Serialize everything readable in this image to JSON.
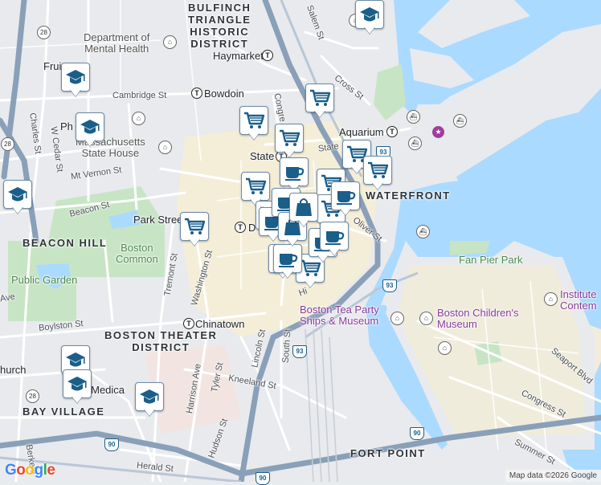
{
  "map": {
    "attribution": "Map data ©2026 Google",
    "logo": "Google",
    "colors": {
      "water": "#aadaff",
      "land": "#e8eaed",
      "park": "#c7e5c4",
      "road": "#ffffff",
      "highway": "#8aa0b8",
      "dense": "#f7efd7",
      "marker_icon": "#1a5e8a"
    }
  },
  "districts": [
    {
      "name": "bulfinch",
      "text": "BULFINCH\nTRIANGLE\nHISTORIC\nDISTRICT"
    },
    {
      "name": "beacon-hill",
      "text": "BEACON HILL"
    },
    {
      "name": "waterfront",
      "text": "WATERFRONT"
    },
    {
      "name": "boston-theater",
      "text": "BOSTON THEATER\nDISTRICT"
    },
    {
      "name": "bay-village",
      "text": "BAY VILLAGE"
    },
    {
      "name": "fort-point",
      "text": "FORT POINT"
    }
  ],
  "places": [
    {
      "name": "haymarket",
      "text": "Haymarket"
    },
    {
      "name": "bowdoin",
      "text": "Bowdoin"
    },
    {
      "name": "aquarium",
      "text": "Aquarium"
    },
    {
      "name": "state",
      "text": "State"
    },
    {
      "name": "park-street",
      "text": "Park Street"
    },
    {
      "name": "chinatown",
      "text": "Chinatown"
    },
    {
      "name": "dept-mental-health",
      "text": "Department of\nMental Health"
    },
    {
      "name": "mass-state-house",
      "text": "Massachusetts\nState House"
    },
    {
      "name": "boston-common",
      "text": "Boston\nCommon"
    },
    {
      "name": "public-garden",
      "text": "Public Garden"
    },
    {
      "name": "fan-pier-park",
      "text": "Fan Pier Park"
    },
    {
      "name": "tea-party",
      "text": "Boston Tea Party\nShips & Museum"
    },
    {
      "name": "childrens-museum",
      "text": "Boston Children's\nMuseum"
    },
    {
      "name": "institute",
      "text": "Institute\nContem"
    },
    {
      "name": "church",
      "text": "hurch"
    },
    {
      "name": "medica",
      "text": "s Medica"
    },
    {
      "name": "d-station",
      "text": "D"
    },
    {
      "name": "fruit",
      "text": "Fruit"
    },
    {
      "name": "ph",
      "text": "Ph"
    }
  ],
  "streets": [
    {
      "name": "cambridge-st",
      "text": "Cambridge St"
    },
    {
      "name": "salem-st",
      "text": "Salem St"
    },
    {
      "name": "cross-st",
      "text": "Cross St"
    },
    {
      "name": "congress-st-n",
      "text": "Congre"
    },
    {
      "name": "state-st",
      "text": "State"
    },
    {
      "name": "mt-vernon-st",
      "text": "Mt Vernon St"
    },
    {
      "name": "charles-st",
      "text": "Charles St"
    },
    {
      "name": "w-cedar-st",
      "text": "W Cedar St"
    },
    {
      "name": "beacon-st",
      "text": "Beacon St"
    },
    {
      "name": "tremont-st",
      "text": "Tremont St"
    },
    {
      "name": "washington-st",
      "text": "Washington St"
    },
    {
      "name": "boylston-st",
      "text": "Boylston St"
    },
    {
      "name": "oliver-st",
      "text": "Oliver St"
    },
    {
      "name": "lincoln-st",
      "text": "Lincoln St"
    },
    {
      "name": "south-st",
      "text": "South St"
    },
    {
      "name": "kneeland-st",
      "text": "Kneeland St"
    },
    {
      "name": "harrison-ave",
      "text": "Harrison Ave"
    },
    {
      "name": "tyler-st",
      "text": "Tyler St"
    },
    {
      "name": "hudson-st",
      "text": "Hudson St"
    },
    {
      "name": "herald-st",
      "text": "Herald St"
    },
    {
      "name": "seaport-blvd",
      "text": "Seaport Blvd"
    },
    {
      "name": "congress-st-s",
      "text": "Congress St"
    },
    {
      "name": "summer-st",
      "text": "Summer St"
    },
    {
      "name": "berkeley-st",
      "text": "Berkele"
    },
    {
      "name": "ave",
      "text": "Ave"
    },
    {
      "name": "hi",
      "text": "Hi"
    }
  ],
  "highways": [
    {
      "name": "route-28-a",
      "text": "28"
    },
    {
      "name": "route-28-b",
      "text": "28"
    },
    {
      "name": "route-28-c",
      "text": "28"
    },
    {
      "name": "i93-a",
      "text": "93"
    },
    {
      "name": "i93-b",
      "text": "93"
    },
    {
      "name": "i93-c",
      "text": "93"
    },
    {
      "name": "i90-a",
      "text": "90"
    },
    {
      "name": "i90-b",
      "text": "90"
    },
    {
      "name": "i90-c",
      "text": "90"
    }
  ],
  "markers": [
    {
      "type": "education"
    },
    {
      "type": "education"
    },
    {
      "type": "education"
    },
    {
      "type": "education"
    },
    {
      "type": "education"
    },
    {
      "type": "education"
    },
    {
      "type": "education"
    },
    {
      "type": "grocery"
    },
    {
      "type": "grocery"
    },
    {
      "type": "grocery"
    },
    {
      "type": "grocery"
    },
    {
      "type": "grocery"
    },
    {
      "type": "grocery"
    },
    {
      "type": "grocery"
    },
    {
      "type": "grocery"
    },
    {
      "type": "grocery"
    },
    {
      "type": "grocery"
    },
    {
      "type": "grocery"
    },
    {
      "type": "grocery"
    },
    {
      "type": "cafe"
    },
    {
      "type": "cafe"
    },
    {
      "type": "cafe"
    },
    {
      "type": "cafe"
    },
    {
      "type": "cafe"
    },
    {
      "type": "cafe"
    },
    {
      "type": "cafe"
    },
    {
      "type": "shopping"
    },
    {
      "type": "shopping"
    }
  ]
}
